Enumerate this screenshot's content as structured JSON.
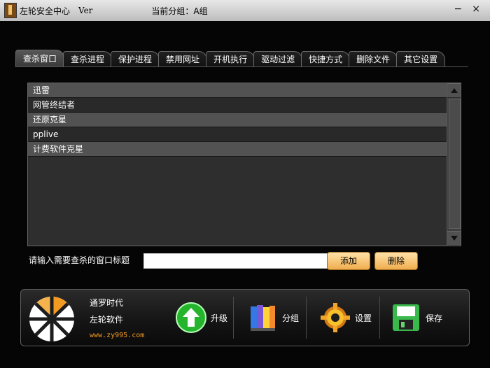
{
  "window": {
    "title": "左轮安全中心",
    "version": "Ver",
    "group_label": "当前分组：A组",
    "minimize": "−",
    "close": "×"
  },
  "tabs": [
    {
      "label": "查杀窗口",
      "active": true
    },
    {
      "label": "查杀进程"
    },
    {
      "label": "保护进程"
    },
    {
      "label": "禁用网址"
    },
    {
      "label": "开机执行"
    },
    {
      "label": "驱动过滤"
    },
    {
      "label": "快捷方式"
    },
    {
      "label": "删除文件"
    },
    {
      "label": "其它设置"
    }
  ],
  "list": {
    "items": [
      "迅雷",
      "网管终结者",
      "还原克星",
      "pplive",
      "计费软件克星"
    ]
  },
  "input": {
    "label": "请输入需要查杀的窗口标题",
    "value": "",
    "placeholder": ""
  },
  "actions": {
    "add": "添加",
    "delete": "删除"
  },
  "brand": {
    "line1": "通罗时代",
    "line2": "左轮软件",
    "url": "www.zy995.com"
  },
  "toolbar": {
    "upgrade": "升级",
    "group": "分组",
    "settings": "设置",
    "save": "保存"
  }
}
